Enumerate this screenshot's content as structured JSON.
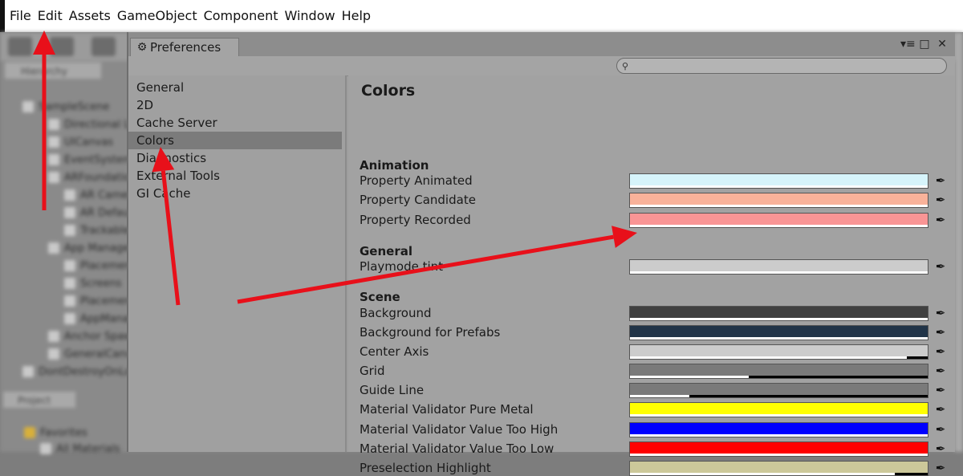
{
  "menu": [
    "File",
    "Edit",
    "Assets",
    "GameObject",
    "Component",
    "Window",
    "Help"
  ],
  "background_editor": {
    "hierarchy_tab": "Hierarchy",
    "rows": [
      "SampleScene",
      "Directional Light",
      "UICanvas",
      "EventSystem",
      "ARFoundation",
      "AR Camera",
      "AR Default",
      "Trackables",
      "App Manager",
      "Placement",
      "Screens",
      "Placement",
      "AppManager",
      "Anchor Spawner",
      "GeneralCanvas",
      "DontDestroyOnLoad"
    ],
    "project_tab": "Project",
    "favorites": "Favorites",
    "all_materials": "All Materials"
  },
  "window": {
    "tab_title": "Preferences",
    "controls": [
      "▾≡",
      "□",
      "✕"
    ],
    "search_placeholder": ""
  },
  "sidebar": {
    "items": [
      "General",
      "2D",
      "Cache Server",
      "Colors",
      "Diagnostics",
      "External Tools",
      "GI Cache"
    ],
    "selected": "Colors"
  },
  "content": {
    "title": "Colors",
    "sections": [
      {
        "header": "Animation",
        "rows": [
          {
            "label": "Property Animated",
            "color": "#d6f4fb"
          },
          {
            "label": "Property Candidate",
            "color": "#f9b29a"
          },
          {
            "label": "Property Recorded",
            "color": "#f99595"
          }
        ]
      },
      {
        "header": "General",
        "rows": [
          {
            "label": "Playmode tint",
            "color": "#cccccc"
          }
        ]
      },
      {
        "header": "Scene",
        "rows": [
          {
            "label": "Background",
            "color": "#404040"
          },
          {
            "label": "Background for Prefabs",
            "color": "#213448"
          },
          {
            "label": "Center Axis",
            "color": "#cccccc",
            "alpha": 0.93
          },
          {
            "label": "Grid",
            "color": "#7a7a7a",
            "alpha": 0.4
          },
          {
            "label": "Guide Line",
            "color": "#7a7a7a",
            "alpha": 0.2
          },
          {
            "label": "Material Validator Pure Metal",
            "color": "#ffff00"
          },
          {
            "label": "Material Validator Value Too High",
            "color": "#0000ff"
          },
          {
            "label": "Material Validator Value Too Low",
            "color": "#ff0000"
          },
          {
            "label": "Preselection Highlight",
            "color": "#ccc89a",
            "alpha": 0.89
          }
        ]
      }
    ]
  },
  "annotation_color": "#e8101a"
}
